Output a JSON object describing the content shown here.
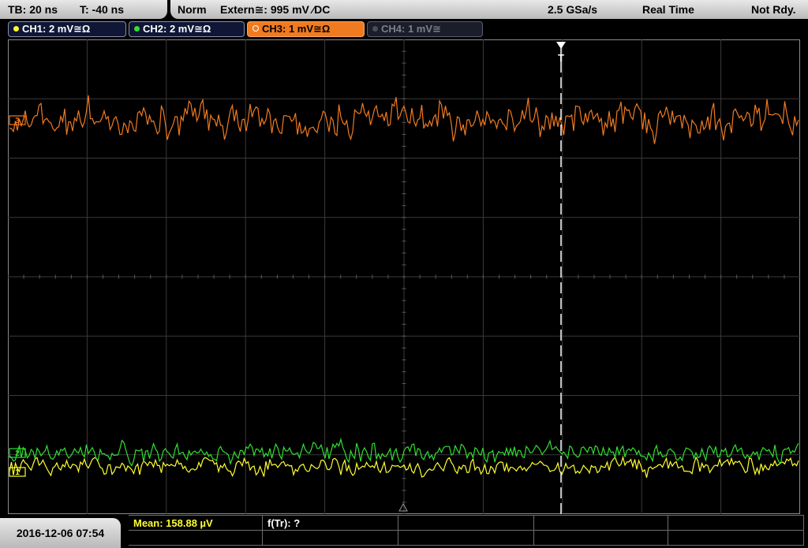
{
  "status_bar": {
    "timebase": "TB: 20 ns",
    "trigger_offset": "T: -40 ns",
    "trigger_mode": "Norm",
    "trigger_source": "Extern≅: 995 mV ⁄DC",
    "sample_rate": "2.5 GSa/s",
    "acquisition": "Real Time",
    "state": "Not Rdy."
  },
  "channels": [
    {
      "label": "CH1: 2 mV≅Ω",
      "color": "#ffff30",
      "active": true
    },
    {
      "label": "CH2: 2 mV≅Ω",
      "color": "#30e030",
      "active": true
    },
    {
      "label": "CH3: 1 mV≅Ω",
      "color": "#f07a20",
      "active": true,
      "selected": true
    },
    {
      "label": "CH4: 1 mV≅",
      "color": "#6a6d78",
      "active": false
    }
  ],
  "markers": {
    "trigger": "T",
    "ch1": "1",
    "ch2": "2",
    "ch3": "3"
  },
  "measurements": {
    "mean": "Mean: 158.88 µV",
    "frequency": "f(Tr): ?"
  },
  "datetime": "2016-12-06 07:54"
}
